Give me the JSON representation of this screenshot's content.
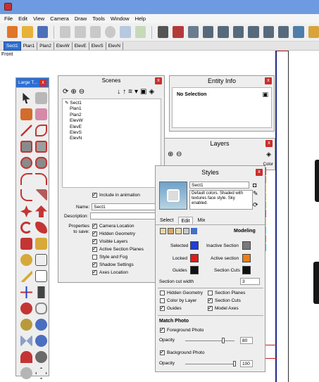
{
  "menu": [
    "File",
    "Edit",
    "View",
    "Camera",
    "Draw",
    "Tools",
    "Window",
    "Help"
  ],
  "scene_tabs": [
    "Sect1",
    "Plan1",
    "Plan2",
    "ElevW",
    "ElevE",
    "ElevS",
    "ElevN"
  ],
  "view_label": "Front",
  "large_tool_set": {
    "title": "Large T...",
    "close": "x"
  },
  "scenes_panel": {
    "title": "Scenes",
    "close": "x",
    "list": [
      "Sect1",
      "Plan1",
      "Plan2",
      "ElevW",
      "ElevE",
      "ElevS",
      "ElevN"
    ],
    "include_animation": "Include in animation",
    "name_label": "Name:",
    "name_value": "Sect1",
    "description_label": "Description:",
    "properties_label": "Properties",
    "to_save_label": "to save:",
    "properties": [
      "Camera Location",
      "Hidden Geometry",
      "Visible Layers",
      "Active Section Planes",
      "Style and Fog",
      "Shadow Settings",
      "Axes Location"
    ],
    "properties_checked": [
      true,
      true,
      true,
      true,
      false,
      true,
      true
    ]
  },
  "entity_info": {
    "title": "Entity Info",
    "close": "x",
    "selection": "No Selection"
  },
  "layers": {
    "title": "Layers",
    "close": "x",
    "col_color": "Color"
  },
  "styles": {
    "title": "Styles",
    "close": "x",
    "name": "Sect1",
    "description": "Default colors. Shaded with textures face style. Sky enabled.",
    "tabs": [
      "Select",
      "Edit",
      "Mix"
    ],
    "active_tab": "Edit",
    "modeling_label": "Modeling",
    "selected": "Selected",
    "inactive_section": "Inactive Section",
    "locked": "Locked",
    "active_section": "Active section",
    "guides": "Guides",
    "section_cuts": "Section Cuts",
    "section_cut_width_label": "Section cut width",
    "section_cut_width": "3",
    "hidden_geometry": "Hidden Geometry",
    "section_planes": "Section Planes",
    "color_by_layer": "Color by Layer",
    "section_cuts_cb": "Section Cuts",
    "guides_cb": "Guides",
    "model_axes": "Model Axes",
    "match_photo": "Match Photo",
    "foreground_photo": "Foreground Photo",
    "opacity_label": "Opacity",
    "opacity_fg": "80",
    "background_photo": "Background Photo",
    "opacity_bg": "100",
    "colors": {
      "selected": "#1f3fd6",
      "inactive_section": "#7a7a7a",
      "locked": "#e21a1a",
      "active_section": "#f07d10",
      "guides": "#111111",
      "section_cuts": "#111111"
    }
  },
  "colors": {
    "title_bar": "#6d9ae0",
    "active_tab": "#2e6fd1",
    "close": "#c9302c"
  }
}
